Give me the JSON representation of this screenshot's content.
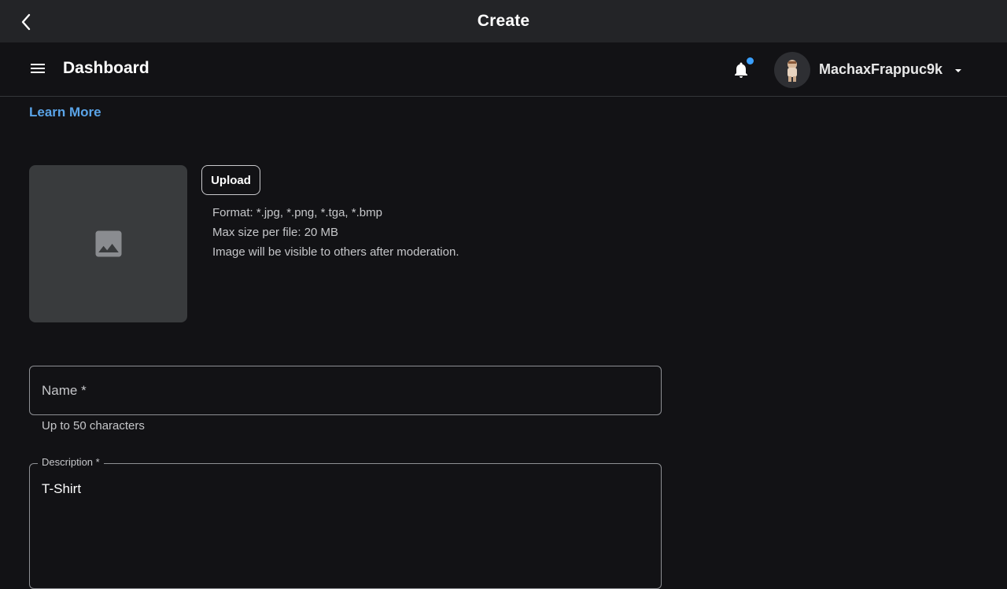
{
  "topbar": {
    "title": "Create",
    "back_icon": "chevron-left-icon"
  },
  "header": {
    "title": "Dashboard",
    "menu_icon": "hamburger-menu-icon",
    "notification_icon": "bell-icon",
    "notification_dot_color": "#3aa0ff",
    "username": "MachaxFrappuc9k",
    "dropdown_icon": "caret-down-icon"
  },
  "learn_more": "Learn More",
  "upload": {
    "button_label": "Upload",
    "preview_icon": "image-placeholder-icon",
    "format_text": "Format: *.jpg, *.png, *.tga, *.bmp",
    "max_size_text": "Max size per file: 20 MB",
    "moderation_text": "Image will be visible to others after moderation."
  },
  "form": {
    "name": {
      "label": "Name *",
      "value": "",
      "helper": "Up to 50 characters"
    },
    "description": {
      "label": "Description *",
      "value": "T-Shirt"
    }
  },
  "colors": {
    "accent_link": "#5aa4e8",
    "background": "#121215",
    "topbar": "#232427"
  }
}
